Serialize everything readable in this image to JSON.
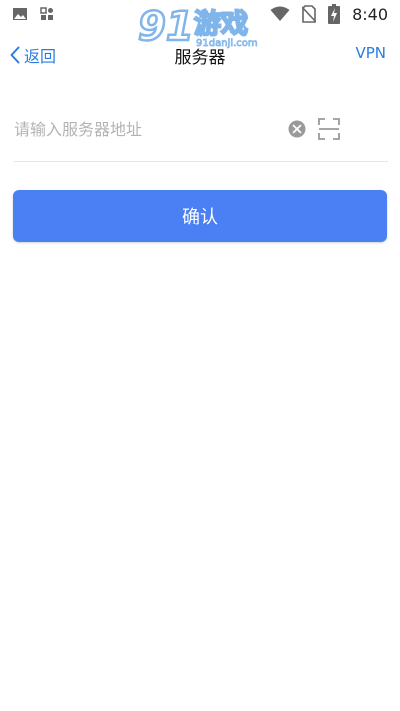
{
  "status_bar": {
    "time": "8:40",
    "icons_left": [
      "image-icon",
      "apps-icon"
    ],
    "icons_right": [
      "wifi-icon",
      "no-sim-icon",
      "battery-charging-icon"
    ]
  },
  "watermark": {
    "brand_digits": "91",
    "brand_text": "游戏",
    "site": "91danji.com"
  },
  "nav": {
    "back_label": "返回",
    "title": "服务器",
    "right_label": "VPN"
  },
  "form": {
    "server_value": "",
    "server_placeholder": "请输入服务器地址"
  },
  "confirm_label": "确认",
  "colors": {
    "accent": "#2a7de0",
    "button": "#4b80f4",
    "placeholder": "#b3b3b3",
    "divider": "#e6e6e6"
  }
}
